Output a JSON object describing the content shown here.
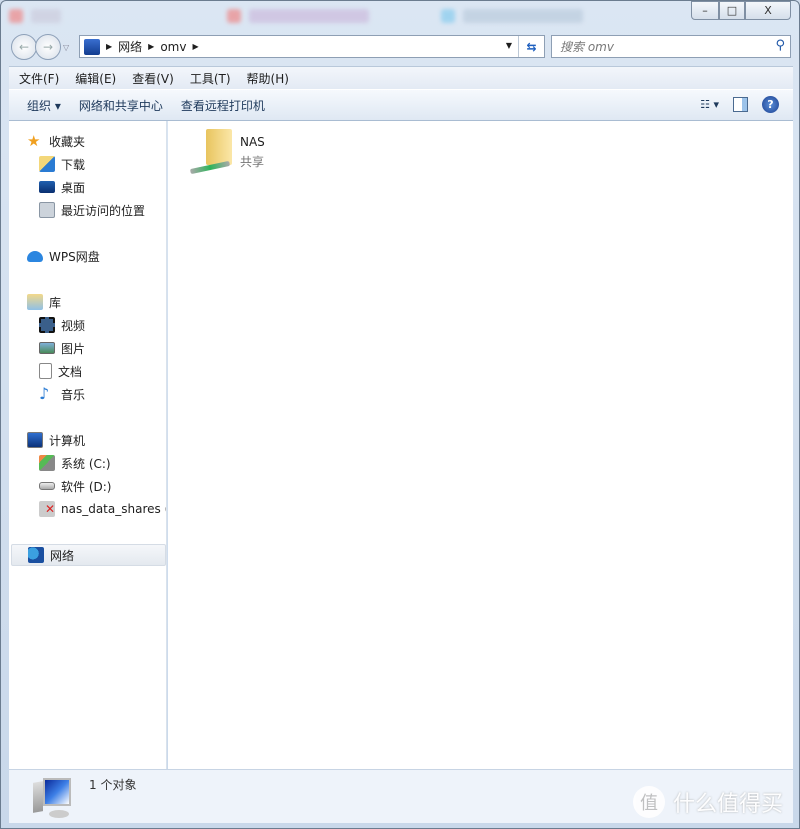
{
  "window": {
    "minimize": "–",
    "maximize": "□",
    "close": "X"
  },
  "address": {
    "crumbs": [
      "网络",
      "omv"
    ]
  },
  "search": {
    "placeholder": "搜索 omv"
  },
  "menu": [
    "文件(F)",
    "编辑(E)",
    "查看(V)",
    "工具(T)",
    "帮助(H)"
  ],
  "toolbar": {
    "organize": "组织 ▾",
    "network_center": "网络和共享中心",
    "printers": "查看远程打印机",
    "help": "?"
  },
  "sidebar": {
    "favorites": {
      "label": "收藏夹",
      "items": [
        "下载",
        "桌面",
        "最近访问的位置"
      ]
    },
    "wps": "WPS网盘",
    "libraries": {
      "label": "库",
      "items": [
        "视频",
        "图片",
        "文档",
        "音乐"
      ]
    },
    "computer": {
      "label": "计算机",
      "items": [
        "系统 (C:)",
        "软件 (D:)",
        "nas_data_shares (\\"
      ]
    },
    "network": "网络"
  },
  "content": {
    "items": [
      {
        "name": "NAS",
        "type": "共享"
      }
    ]
  },
  "status": {
    "text": "1 个对象"
  },
  "watermark": {
    "logo": "值",
    "text": "什么值得买"
  }
}
